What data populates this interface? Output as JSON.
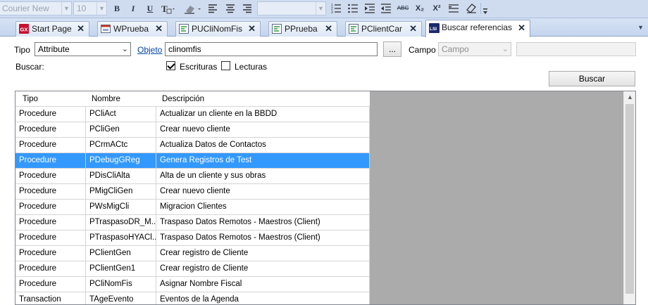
{
  "toolbar": {
    "font_name": "Courier New",
    "font_size": "10",
    "bold_label": "B",
    "italic_label": "I",
    "underline_label": "U",
    "abc_label": "ABC",
    "subscript_label": "X₂",
    "superscript_label": "X²"
  },
  "tabs": [
    {
      "label": "Start Page",
      "icon": "gx-icon",
      "active": false
    },
    {
      "label": "WPrueba",
      "icon": "webpanel-icon",
      "active": false
    },
    {
      "label": "PUCliNomFis",
      "icon": "procedure-icon",
      "active": false
    },
    {
      "label": "PPrueba",
      "icon": "procedure-icon",
      "active": false
    },
    {
      "label": "PClientCar",
      "icon": "procedure-icon",
      "active": false
    },
    {
      "label": "Buscar referencias",
      "icon": "lsi-icon",
      "active": true
    }
  ],
  "tab_icon_texts": {
    "start": "GX",
    "lsi": "LSI"
  },
  "close_glyph": "✕",
  "form": {
    "tipo_label": "Tipo",
    "tipo_value": "Attribute",
    "objeto_link": "Objeto",
    "objeto_value": "clinomfis",
    "ellipsis_label": "...",
    "campo_label": "Campo",
    "campo_value": "Campo",
    "buscar_label": "Buscar:",
    "escrituras_label": "Escrituras",
    "escrituras_checked": true,
    "lecturas_label": "Lecturas",
    "lecturas_checked": false,
    "buscar_button": "Buscar"
  },
  "grid": {
    "columns": [
      "Tipo",
      "Nombre",
      "Descripción"
    ],
    "rows": [
      [
        "Procedure",
        "PCliAct",
        "Actualizar un cliente en la BBDD"
      ],
      [
        "Procedure",
        "PCliGen",
        "Crear nuevo cliente"
      ],
      [
        "Procedure",
        "PCrmACtc",
        "Actualiza Datos de Contactos"
      ],
      [
        "Procedure",
        "PDebugGReg",
        "Genera Registros de Test"
      ],
      [
        "Procedure",
        "PDisCliAlta",
        "Alta de un cliente y sus obras"
      ],
      [
        "Procedure",
        "PMigCliGen",
        "Crear nuevo cliente"
      ],
      [
        "Procedure",
        "PWsMigCli",
        "Migracion Clientes"
      ],
      [
        "Procedure",
        "PTraspasoDR_M...",
        "Traspaso Datos Remotos - Maestros (Client)"
      ],
      [
        "Procedure",
        "PTraspasoHYACl...",
        "Traspaso Datos Remotos - Maestros (Client)"
      ],
      [
        "Procedure",
        "PClientGen",
        "Crear registro de Cliente"
      ],
      [
        "Procedure",
        "PClientGen1",
        "Crear registro de Cliente"
      ],
      [
        "Procedure",
        "PCliNomFis",
        "Asignar Nombre Fiscal"
      ],
      [
        "Transaction",
        "TAgeEvento",
        "Eventos de la Agenda"
      ]
    ],
    "selected_row": 3
  },
  "colors": {
    "selection": "#3399ff",
    "tab_bg": "#cfdcf0"
  }
}
